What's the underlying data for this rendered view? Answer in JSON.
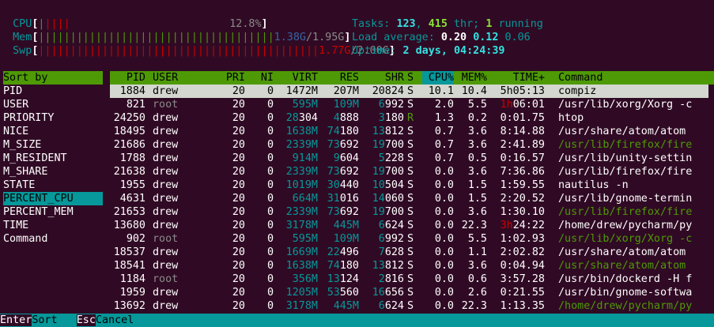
{
  "meters": {
    "cpu": {
      "label": "CPU",
      "bar_green": "|",
      "bar_red": "||||",
      "value": "12.8%"
    },
    "mem": {
      "label": "Mem",
      "bar_green": "|||||||||||||||||||||||||||||||||||||",
      "value_a": "1.38G",
      "slash": "/",
      "value_b": "1.95G"
    },
    "swp": {
      "label": "Swp",
      "bar_red": "||||||||||||||||||||||||||||||||||||||||||||",
      "value_a": "1.77G",
      "slash": "/",
      "value_b": "2.00G"
    }
  },
  "stats": {
    "tasks_label": "Tasks:",
    "tasks": "123",
    "thr": "415",
    "thr_label": "thr;",
    "running": "1",
    "running_label": "running",
    "load_label": "Load average:",
    "load1": "0.20",
    "load5": "0.12",
    "load15": "0.06",
    "uptime_label": "Uptime:",
    "uptime": "2 days, 04:24:39"
  },
  "sort_menu": {
    "header": "Sort by",
    "options": [
      "PID",
      "USER",
      "PRIORITY",
      "NICE",
      "M_SIZE",
      "M_RESIDENT",
      "M_SHARE",
      "STATE",
      "PERCENT_CPU",
      "PERCENT_MEM",
      "TIME",
      "Command"
    ],
    "selected": "PERCENT_CPU"
  },
  "table": {
    "columns": [
      "PID",
      "USER",
      "PRI",
      "NI",
      "VIRT",
      "RES",
      "SHR",
      "S",
      "CPU%",
      "MEM%",
      "TIME+",
      "Command"
    ],
    "sorted_column": "CPU%",
    "rows": [
      {
        "pid": "1884",
        "user": "drew",
        "pri": "20",
        "ni": "0",
        "virt": "1472M",
        "res": "207M",
        "shr": "20824",
        "s": "S",
        "cpu": "10.1",
        "mem": "10.4",
        "time": "5h05:13",
        "cmd": "compiz"
      },
      {
        "pid": "821",
        "user": "root",
        "pri": "20",
        "ni": "0",
        "virt": "595M",
        "res": "109M",
        "shr": "6992",
        "s": "S",
        "cpu": "2.0",
        "mem": "5.5",
        "time": "1h06:01",
        "cmd": "/usr/lib/xorg/Xorg -c"
      },
      {
        "pid": "24250",
        "user": "drew",
        "pri": "20",
        "ni": "0",
        "virt": "28304",
        "res": "4888",
        "shr": "3180",
        "s": "R",
        "cpu": "1.3",
        "mem": "0.2",
        "time": "0:01.75",
        "cmd": "htop"
      },
      {
        "pid": "18495",
        "user": "drew",
        "pri": "20",
        "ni": "0",
        "virt": "1638M",
        "res": "74180",
        "shr": "13812",
        "s": "S",
        "cpu": "0.7",
        "mem": "3.6",
        "time": "8:14.88",
        "cmd": "/usr/share/atom/atom"
      },
      {
        "pid": "21686",
        "user": "drew",
        "pri": "20",
        "ni": "0",
        "virt": "2339M",
        "res": "73692",
        "shr": "19700",
        "s": "S",
        "cpu": "0.7",
        "mem": "3.6",
        "time": "2:41.89",
        "cmd": "/usr/lib/firefox/fire"
      },
      {
        "pid": "1788",
        "user": "drew",
        "pri": "20",
        "ni": "0",
        "virt": "914M",
        "res": "9604",
        "shr": "5228",
        "s": "S",
        "cpu": "0.7",
        "mem": "0.5",
        "time": "0:16.57",
        "cmd": "/usr/lib/unity-settin"
      },
      {
        "pid": "21638",
        "user": "drew",
        "pri": "20",
        "ni": "0",
        "virt": "2339M",
        "res": "73692",
        "shr": "19700",
        "s": "S",
        "cpu": "0.0",
        "mem": "3.6",
        "time": "7:36.86",
        "cmd": "/usr/lib/firefox/fire"
      },
      {
        "pid": "1955",
        "user": "drew",
        "pri": "20",
        "ni": "0",
        "virt": "1019M",
        "res": "30440",
        "shr": "10504",
        "s": "S",
        "cpu": "0.0",
        "mem": "1.5",
        "time": "1:59.55",
        "cmd": "nautilus -n"
      },
      {
        "pid": "4631",
        "user": "drew",
        "pri": "20",
        "ni": "0",
        "virt": "664M",
        "res": "31016",
        "shr": "14060",
        "s": "S",
        "cpu": "0.0",
        "mem": "1.5",
        "time": "2:20.52",
        "cmd": "/usr/lib/gnome-termin"
      },
      {
        "pid": "21653",
        "user": "drew",
        "pri": "20",
        "ni": "0",
        "virt": "2339M",
        "res": "73692",
        "shr": "19700",
        "s": "S",
        "cpu": "0.0",
        "mem": "3.6",
        "time": "1:30.10",
        "cmd": "/usr/lib/firefox/fire"
      },
      {
        "pid": "13680",
        "user": "drew",
        "pri": "20",
        "ni": "0",
        "virt": "3178M",
        "res": "445M",
        "shr": "6624",
        "s": "S",
        "cpu": "0.0",
        "mem": "22.3",
        "time": "3h24:22",
        "cmd": "/home/drew/pycharm/py"
      },
      {
        "pid": "902",
        "user": "root",
        "pri": "20",
        "ni": "0",
        "virt": "595M",
        "res": "109M",
        "shr": "6992",
        "s": "S",
        "cpu": "0.0",
        "mem": "5.5",
        "time": "1:02.93",
        "cmd": "/usr/lib/xorg/Xorg -c"
      },
      {
        "pid": "18537",
        "user": "drew",
        "pri": "20",
        "ni": "0",
        "virt": "1669M",
        "res": "22496",
        "shr": "7628",
        "s": "S",
        "cpu": "0.0",
        "mem": "1.1",
        "time": "2:02.82",
        "cmd": "/usr/share/atom/atom"
      },
      {
        "pid": "18541",
        "user": "drew",
        "pri": "20",
        "ni": "0",
        "virt": "1638M",
        "res": "74180",
        "shr": "13812",
        "s": "S",
        "cpu": "0.0",
        "mem": "3.6",
        "time": "0:04.94",
        "cmd": "/usr/share/atom/atom"
      },
      {
        "pid": "1184",
        "user": "root",
        "pri": "20",
        "ni": "0",
        "virt": "356M",
        "res": "13124",
        "shr": "2816",
        "s": "S",
        "cpu": "0.0",
        "mem": "0.6",
        "time": "3:57.28",
        "cmd": "/usr/bin/dockerd -H f"
      },
      {
        "pid": "1959",
        "user": "drew",
        "pri": "20",
        "ni": "0",
        "virt": "1205M",
        "res": "53560",
        "shr": "16656",
        "s": "S",
        "cpu": "0.0",
        "mem": "2.6",
        "time": "0:21.55",
        "cmd": "/usr/bin/gnome-softwa"
      },
      {
        "pid": "13692",
        "user": "drew",
        "pri": "20",
        "ni": "0",
        "virt": "3178M",
        "res": "445M",
        "shr": "6624",
        "s": "S",
        "cpu": "0.0",
        "mem": "22.3",
        "time": "1:13.35",
        "cmd": "/home/drew/pycharm/py"
      }
    ]
  },
  "footer": {
    "key1": "Enter",
    "action1": "Sort",
    "key2": "Esc",
    "action2": "Cancel"
  }
}
